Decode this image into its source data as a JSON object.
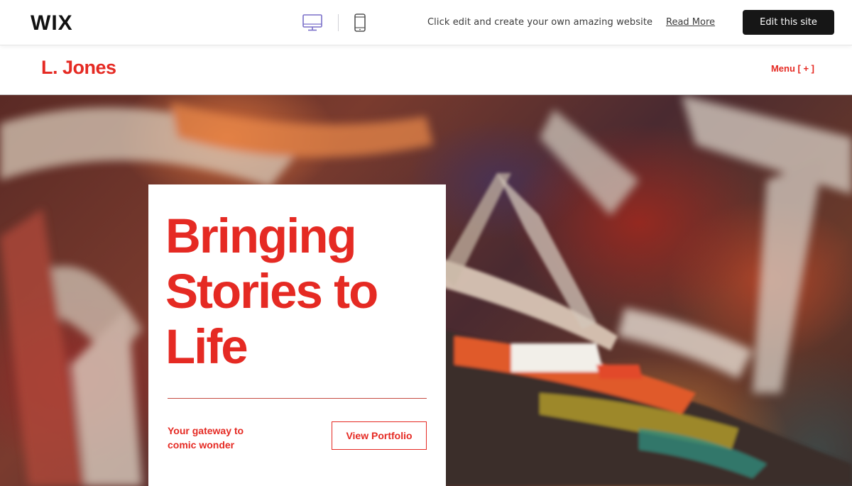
{
  "wix_bar": {
    "logo": "WIX",
    "desktop_icon": "desktop-monitor-icon",
    "mobile_icon": "mobile-phone-icon",
    "promo_text": "Click edit and create your own amazing website",
    "read_more": "Read More",
    "edit_button": "Edit this site"
  },
  "site": {
    "name": "L. Jones",
    "menu": "Menu [ + ]"
  },
  "hero": {
    "title": "Bringing Stories to Life",
    "tagline": "Your gateway to comic wonder",
    "cta": "View Portfolio"
  },
  "colors": {
    "accent": "#e52a23",
    "edit_button_bg": "#161616",
    "desktop_icon": "#7a6fc9"
  }
}
